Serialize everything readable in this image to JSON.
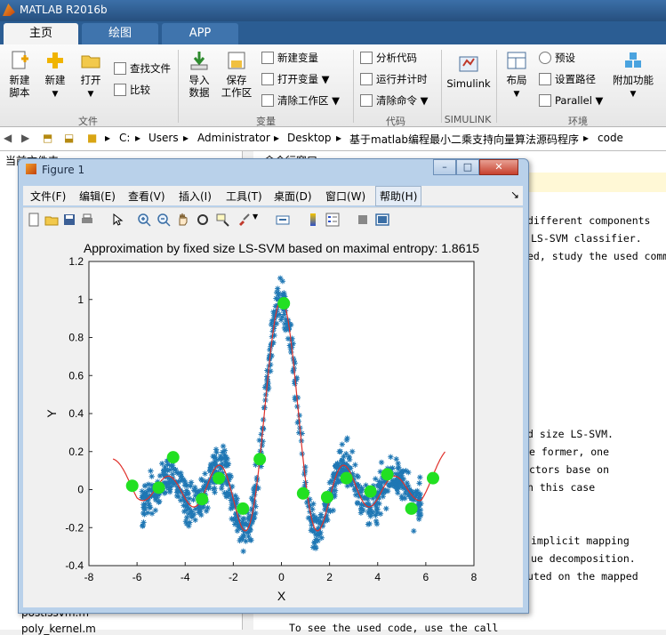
{
  "app": {
    "title": "MATLAB R2016b"
  },
  "tabs": [
    {
      "label": "主页"
    },
    {
      "label": "绘图"
    },
    {
      "label": "APP"
    }
  ],
  "ribbon": {
    "file": {
      "group_label": "文件",
      "new_script": "新建\n脚本",
      "new": "新建",
      "open": "打开",
      "find_files": "查找文件",
      "compare": "比较"
    },
    "variable": {
      "group_label": "变量",
      "import": "导入\n数据",
      "save_ws": "保存\n工作区",
      "new_var": "新建变量",
      "open_var": "打开变量",
      "clear_ws": "清除工作区"
    },
    "code": {
      "group_label": "代码",
      "analyze": "分析代码",
      "run_time": "运行并计时",
      "clear_cmd": "清除命令"
    },
    "simulink": {
      "group_label": "SIMULINK",
      "simulink": "Simulink"
    },
    "env": {
      "group_label": "环境",
      "layout": "布局",
      "prefs": "预设",
      "set_path": "设置路径",
      "parallel": "Parallel",
      "addons": "附加功能"
    }
  },
  "address": {
    "parts": [
      "C:",
      "Users",
      "Administrator",
      "Desktop",
      "基于matlab编程最小二乘支持向量算法源码程序",
      "code"
    ]
  },
  "left_panel": {
    "header": "当前文件夹",
    "files": [
      "postlssvm.m",
      "poly_kernel.m"
    ]
  },
  "command_panel": {
    "header": "命令行窗口",
    "lines": [
      "different components",
      "LS-SVM classifier.",
      "ed, study the used comm",
      "d size LS-SVM.",
      "e former, one",
      "ctors base on",
      "n this case",
      "implicit mapping",
      "ue decomposition.",
      "uted on the mapped",
      "To see the used code, use the call"
    ]
  },
  "figure": {
    "window_title": "Figure 1",
    "menu": [
      "文件(F)",
      "编辑(E)",
      "查看(V)",
      "插入(I)",
      "工具(T)",
      "桌面(D)",
      "窗口(W)",
      "帮助(H)"
    ],
    "toolbar_icons": [
      "new-figure-icon",
      "open-icon",
      "save-icon",
      "print-icon",
      "pointer-icon",
      "zoom-in-icon",
      "zoom-out-icon",
      "pan-icon",
      "rotate-icon",
      "data-cursor-icon",
      "brush-icon",
      "link-icon",
      "colorbar-icon",
      "legend-icon",
      "hide-plot-tools-icon",
      "show-plot-tools-icon"
    ]
  },
  "chart_data": {
    "type": "scatter",
    "title": "Approximation by fixed size LS-SVM based on maximal entropy: 1.8615",
    "xlabel": "X",
    "ylabel": "Y",
    "xlim": [
      -8,
      8
    ],
    "ylim": [
      -0.4,
      1.2
    ],
    "xticks": [
      -8,
      -6,
      -4,
      -2,
      0,
      2,
      4,
      6,
      8
    ],
    "yticks": [
      -0.4,
      -0.2,
      0,
      0.2,
      0.4,
      0.6,
      0.8,
      1,
      1.2
    ],
    "colors": {
      "data": "#1f77b4",
      "fit": "#e0302a",
      "support": "#22e022"
    },
    "data_noise_band": 0.1,
    "data_x_range": [
      -5.8,
      5.8
    ],
    "series": [
      {
        "name": "data",
        "function": "sinc(x)"
      },
      {
        "name": "fit",
        "x_range": [
          -7,
          6.8
        ]
      },
      {
        "name": "support vectors",
        "x": [
          -6.2,
          -5.1,
          -4.5,
          -3.3,
          -2.6,
          -1.6,
          -0.9,
          0.1,
          0.9,
          1.9,
          2.7,
          3.7,
          4.4,
          5.4,
          6.3
        ],
        "y": [
          0.02,
          0.01,
          0.17,
          -0.05,
          0.06,
          -0.1,
          0.16,
          0.98,
          -0.02,
          -0.04,
          0.06,
          -0.01,
          0.08,
          -0.1,
          0.06
        ]
      }
    ]
  }
}
